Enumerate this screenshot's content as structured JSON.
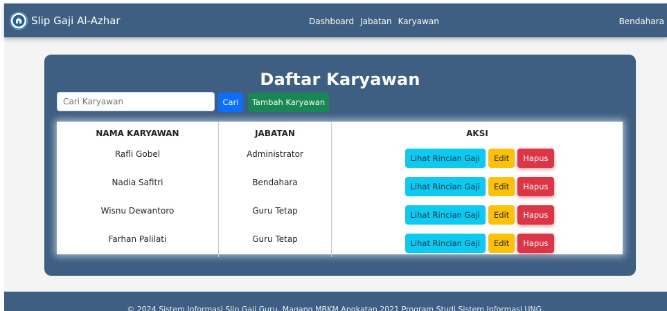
{
  "navbar": {
    "brand": "Slip Gaji Al-Azhar",
    "links": [
      "Dashboard",
      "Jabatan",
      "Karyawan"
    ],
    "user": "Bendahara"
  },
  "main": {
    "title": "Daftar Karyawan",
    "search": {
      "placeholder": "Cari Karyawan",
      "value": ""
    },
    "search_button": "Cari",
    "add_button": "Tambah Karyawan",
    "table": {
      "headers": [
        "NAMA KARYAWAN",
        "JABATAN",
        "AKSI"
      ],
      "rows": [
        {
          "name": "Rafli Gobel",
          "role": "Administrator"
        },
        {
          "name": "Nadia Safitri",
          "role": "Bendahara"
        },
        {
          "name": "Wisnu Dewantoro",
          "role": "Guru Tetap"
        },
        {
          "name": "Farhan Palilati",
          "role": "Guru Tetap"
        }
      ],
      "actions": {
        "view": "Lihat Rincian Gaji",
        "edit": "Edit",
        "delete": "Hapus"
      }
    }
  },
  "footer": {
    "text": "© 2024 Sistem Informasi Slip Gaji Guru, Magang MBKM Angkatan 2021 Program Studi Sistem Informasi UNG."
  },
  "colors": {
    "primary": "#3e5f82",
    "search_button": "#0d6efd",
    "add_button": "#198754",
    "view_button": "#0dcaf0",
    "edit_button": "#ffc107",
    "delete_button": "#dc3545"
  },
  "icons": {
    "brand_logo": "al-azhar-logo-icon"
  }
}
